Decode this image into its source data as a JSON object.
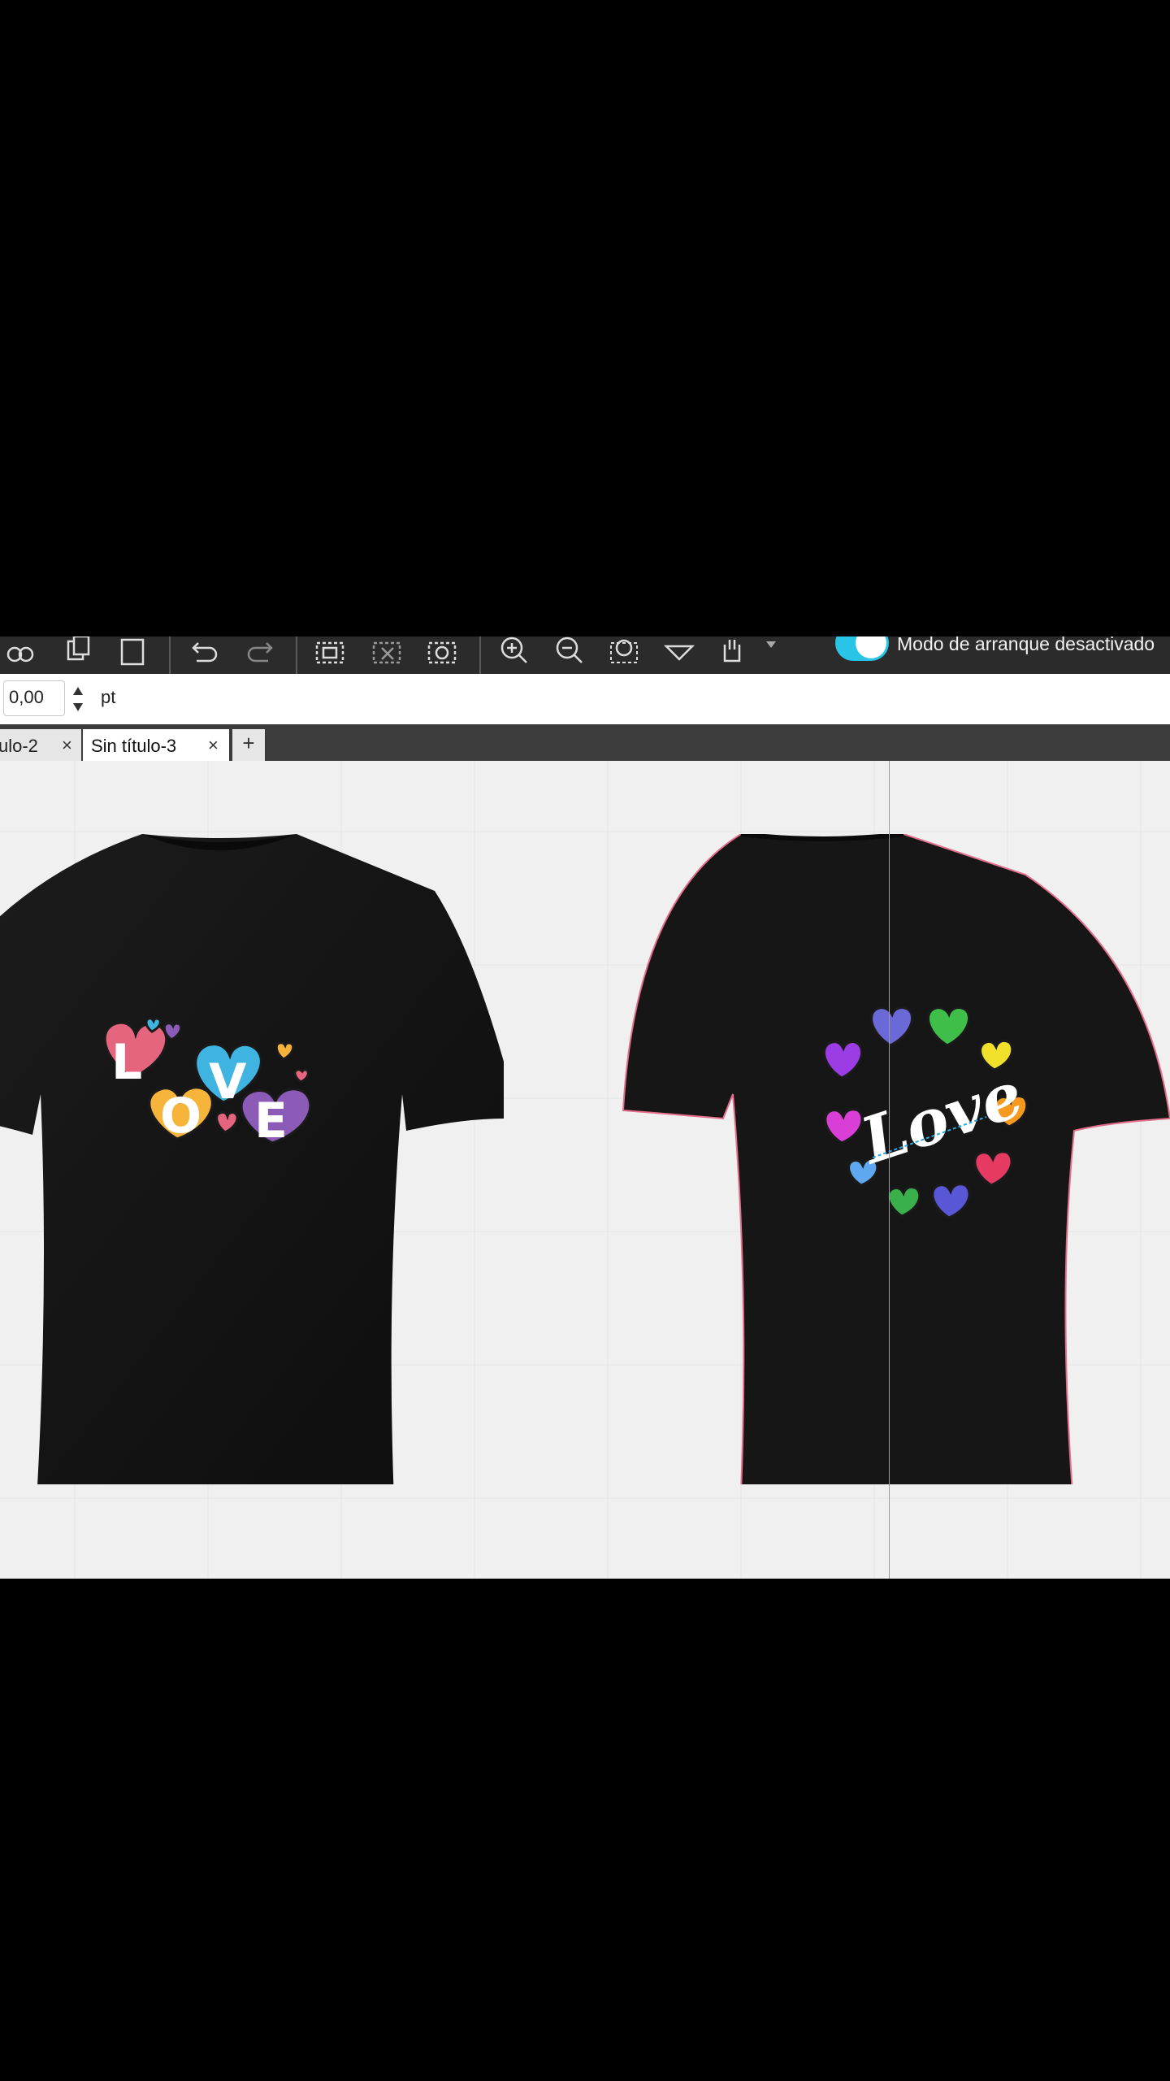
{
  "toolbar": {
    "icons": [
      "link-icon",
      "copy-icon",
      "paste-icon",
      "undo-icon",
      "redo-icon",
      "select-frame-icon",
      "crop-icon",
      "lasso-icon",
      "zoom-in-icon",
      "zoom-out-icon",
      "zoom-fit-icon",
      "shape-icon",
      "hand-icon",
      "dropdown-icon"
    ],
    "toggle_color": "#29c5e6",
    "mode_label": "Modo de arranque desactivado"
  },
  "property_bar": {
    "value": "0,00",
    "unit": "pt"
  },
  "tabs": [
    {
      "label": "ulo-2",
      "close": "×"
    },
    {
      "label": "Sin título-3",
      "close": "×",
      "active": true
    }
  ],
  "tab_add_label": "+",
  "canvas": {
    "shirt_front": {
      "design_letters": [
        "L",
        "O",
        "V",
        "E"
      ],
      "heart_colors": [
        "#e5647e",
        "#f6b43a",
        "#3fb4e0",
        "#8c5bb8"
      ]
    },
    "shirt_back": {
      "design_text": "Love",
      "heart_colors": [
        "#9b3ce4",
        "#6b68d8",
        "#3fbf4a",
        "#f1e12a",
        "#f59a1f",
        "#e53a62",
        "#5a57d6",
        "#39b04a",
        "#5fa8f0",
        "#d93fd6"
      ]
    }
  }
}
